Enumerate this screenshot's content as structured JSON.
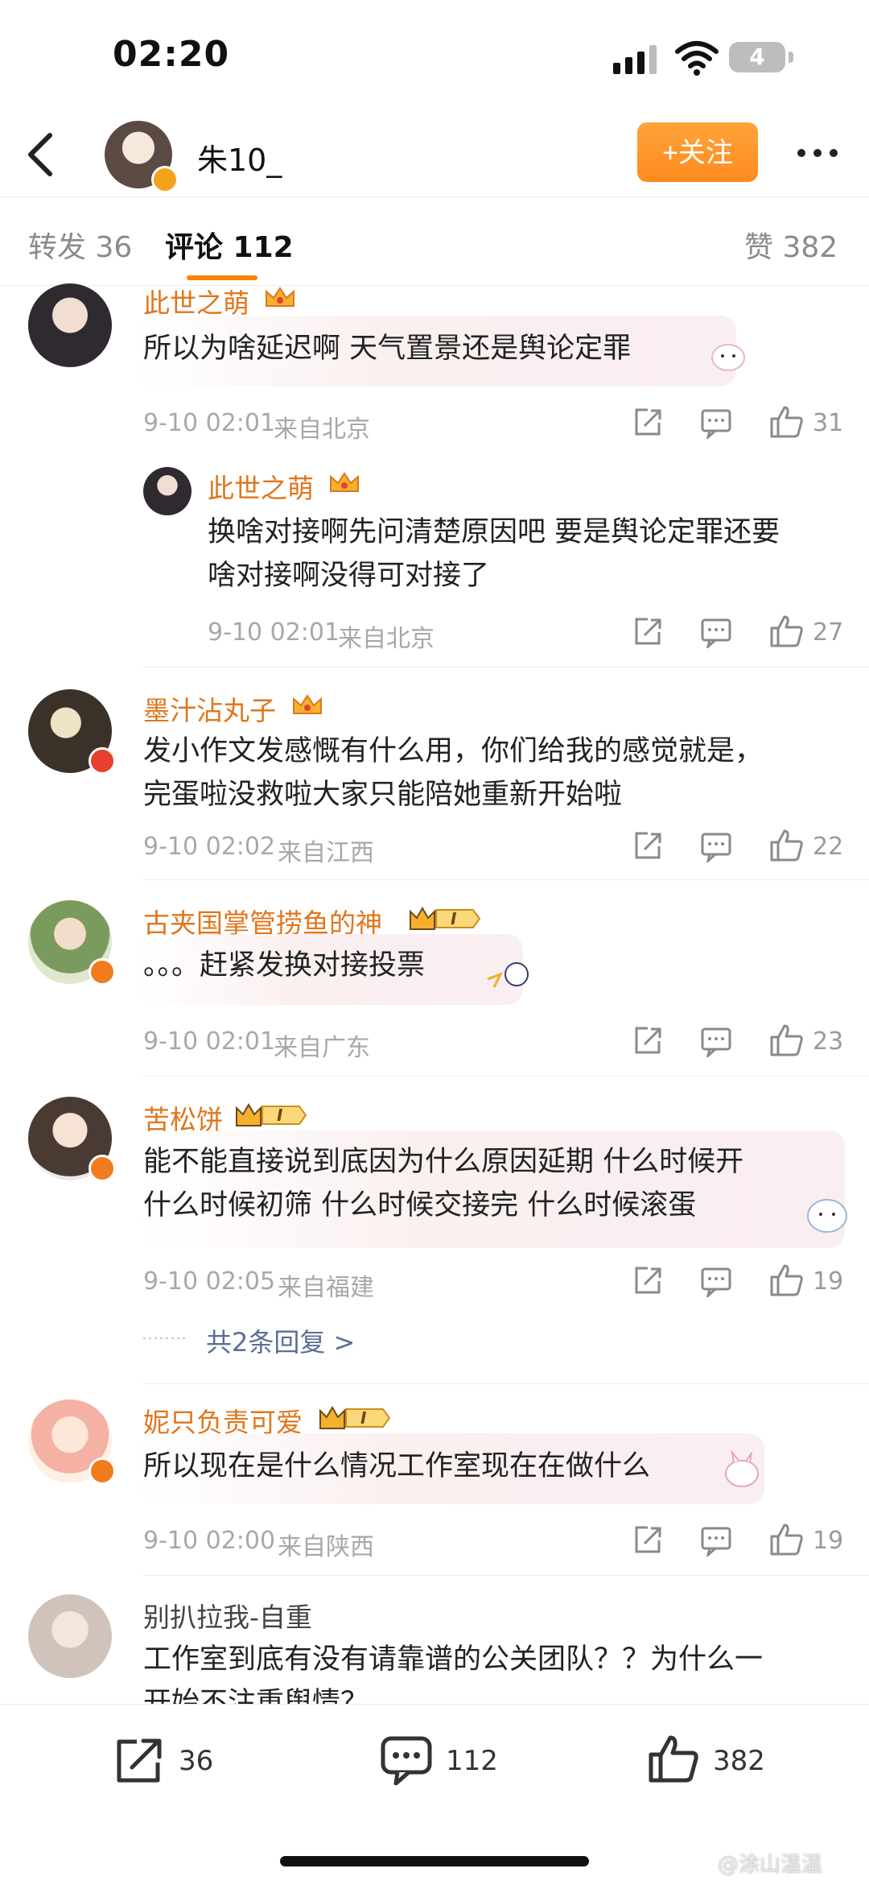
{
  "status_bar": {
    "time": "02:20",
    "battery": "4"
  },
  "header": {
    "username": "朱10_",
    "follow_label": "+关注"
  },
  "tabs": {
    "repost": "转发 36",
    "comments": "评论 112",
    "likes": "赞 382"
  },
  "comments": [
    {
      "user": "此世之萌",
      "text_lines": [
        "所以为啥延迟啊 天气置景还是舆论定罪"
      ],
      "time": "9-10 02:01",
      "location": "来自北京",
      "likes": "31"
    },
    {
      "user": "此世之萌",
      "text_lines": [
        "换啥对接啊先问清楚原因吧 要是舆论定罪还要",
        "啥对接啊没得可对接了"
      ],
      "time": "9-10 02:01",
      "location": "来自北京",
      "likes": "27"
    },
    {
      "user": "墨汁沾丸子",
      "text_lines": [
        "发小作文发感慨有什么用，你们给我的感觉就是，",
        "完蛋啦没救啦大家只能陪她重新开始啦"
      ],
      "time": "9-10 02:02",
      "location": "来自江西",
      "likes": "22"
    },
    {
      "user": "古夹国掌管捞鱼的神",
      "text_lines": [
        "。。。赶紧发换对接投票"
      ],
      "time": "9-10 02:01",
      "location": "来自广东",
      "likes": "23"
    },
    {
      "user": "苦松饼",
      "text_lines": [
        "能不能直接说到底因为什么原因延期 什么时候开",
        "什么时候初筛 什么时候交接完 什么时候滚蛋"
      ],
      "time": "9-10 02:05",
      "location": "来自福建",
      "likes": "19",
      "replies": "共2条回复 >"
    },
    {
      "user": "妮只负责可爱",
      "text_lines": [
        "所以现在是什么情况工作室现在在做什么"
      ],
      "time": "9-10 02:00",
      "location": "来自陕西",
      "likes": "19"
    },
    {
      "user": "别扒拉我-自重",
      "text_lines": [
        "工作室到底有没有请靠谱的公关团队？？为什么一",
        "开始不注重舆情？"
      ]
    }
  ],
  "vip_label": "I",
  "bottom_bar": {
    "repost_count": "36",
    "comment_count": "112",
    "like_count": "382"
  },
  "watermark": "@涂山温温"
}
